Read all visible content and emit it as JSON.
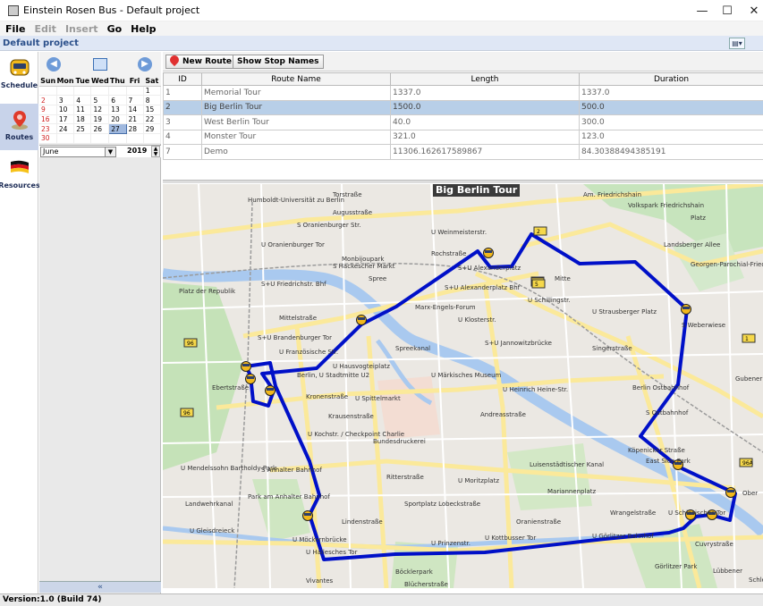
{
  "window": {
    "title": "Einstein Rosen Bus - Default project",
    "controls": {
      "minimize": "—",
      "maximize": "☐",
      "close": "✕"
    }
  },
  "menu": {
    "file": "File",
    "edit": "Edit",
    "insert": "Insert",
    "go": "Go",
    "help": "Help"
  },
  "project": {
    "name": "Default project"
  },
  "nav": {
    "schedule": "Schedule",
    "routes": "Routes",
    "resources": "Resources"
  },
  "calendar": {
    "weekdays": [
      "Sun",
      "Mon",
      "Tue",
      "Wed",
      "Thu",
      "Fri",
      "Sat"
    ],
    "weeks": [
      [
        "",
        "",
        "",
        "",
        "",
        "",
        "1"
      ],
      [
        "2",
        "3",
        "4",
        "5",
        "6",
        "7",
        "8"
      ],
      [
        "9",
        "10",
        "11",
        "12",
        "13",
        "14",
        "15"
      ],
      [
        "16",
        "17",
        "18",
        "19",
        "20",
        "21",
        "22"
      ],
      [
        "23",
        "24",
        "25",
        "26",
        "27",
        "28",
        "29"
      ],
      [
        "30",
        "",
        "",
        "",
        "",
        "",
        ""
      ]
    ],
    "selected_day": "27",
    "month": "June",
    "year": "2019",
    "collapse": "«"
  },
  "toolbar": {
    "new_route": "New Route",
    "show_stop_names": "Show Stop Names"
  },
  "table": {
    "columns": [
      "ID",
      "Route Name",
      "Length",
      "Duration"
    ],
    "rows": [
      {
        "id": "1",
        "name": "Memorial Tour",
        "length": "1337.0",
        "duration": "1337.0"
      },
      {
        "id": "2",
        "name": "Big Berlin Tour",
        "length": "1500.0",
        "duration": "500.0"
      },
      {
        "id": "3",
        "name": "West Berlin Tour",
        "length": "40.0",
        "duration": "300.0"
      },
      {
        "id": "4",
        "name": "Monster Tour",
        "length": "321.0",
        "duration": "123.0"
      },
      {
        "id": "7",
        "name": "Demo",
        "length": "11306.162617589867",
        "duration": "84.30388494385191"
      }
    ],
    "selected_row": 1
  },
  "map": {
    "title": "Big Berlin Tour",
    "route_color": "#0010c8",
    "labels": [
      "Torstraße",
      "Humboldt-Universität zu Berlin",
      "S Oranienburger Str.",
      "Augusstraße",
      "U Oranienburger Tor",
      "Monbijoupark",
      "S Hackescher Markt",
      "U Weinmeisterstr.",
      "Am. Friedrichshain",
      "Volkspark Friedrichshain",
      "S+U Alexanderplatz",
      "S+U Alexanderplatz Bhf",
      "Mitte",
      "Landsberger Allee",
      "Georgen-Parochial-Friedhof II",
      "S+U Friedrichstr. Bhf",
      "Spree",
      "Platz der Republik",
      "Mittelstraße",
      "Marx-Engels-Forum",
      "U Klosterstr.",
      "U Schillingstr.",
      "U Strausberger Platz",
      "S Weberwiese",
      "Spreekanal",
      "S+U Brandenburger Tor",
      "U Französische Str.",
      "U Hausvogteiplatz",
      "U Märkisches Museum",
      "S+U Jannowitzbrücke",
      "Singerstraße",
      "Berlin, U Stadtmitte U2",
      "Kronenstraße",
      "U Spittelmarkt",
      "U Heinrich Heine-Str.",
      "Krausenstraße",
      "S Ostbahnhof",
      "Berlin Ostbahnhof",
      "U Kochstr. / Checkpoint Charlie",
      "Bundesdruckerei",
      "Köpenicker Straße",
      "East Side Park",
      "U Mendelssohn Bartholdy-Park",
      "S Anhalter Bahnhof",
      "Luisenstädtischer Kanal",
      "Mariannenplatz",
      "U Moritzplatz",
      "Park am Anhalter Bahnhof",
      "Ritterstraße",
      "Sportplatz Lobeckstraße",
      "Oranienstraße",
      "Wrangelstraße",
      "U Schlesisches Tor",
      "U Gleisdreieck",
      "U Möckernbrücke",
      "U Hallesches Tor",
      "U Prinzenstr.",
      "U Kottbusser Tor",
      "U Görlitzer Bahnhof",
      "Görlitzer Park",
      "Böcklerpark",
      "Blücherstraße",
      "Vivantes",
      "Lindenstraße",
      "Landwehrkanal",
      "Ebertstraße",
      "Cuvrystraße",
      "Schles",
      "Ober",
      "Gubener Straße",
      "Andreasstraße",
      "Rochstraße",
      "Platz",
      "Lübbener"
    ],
    "road_numbers": [
      "2",
      "2",
      "5",
      "5",
      "96",
      "96",
      "1",
      "96A"
    ]
  },
  "status": {
    "version": "Version:1.0 (Build 74)"
  }
}
